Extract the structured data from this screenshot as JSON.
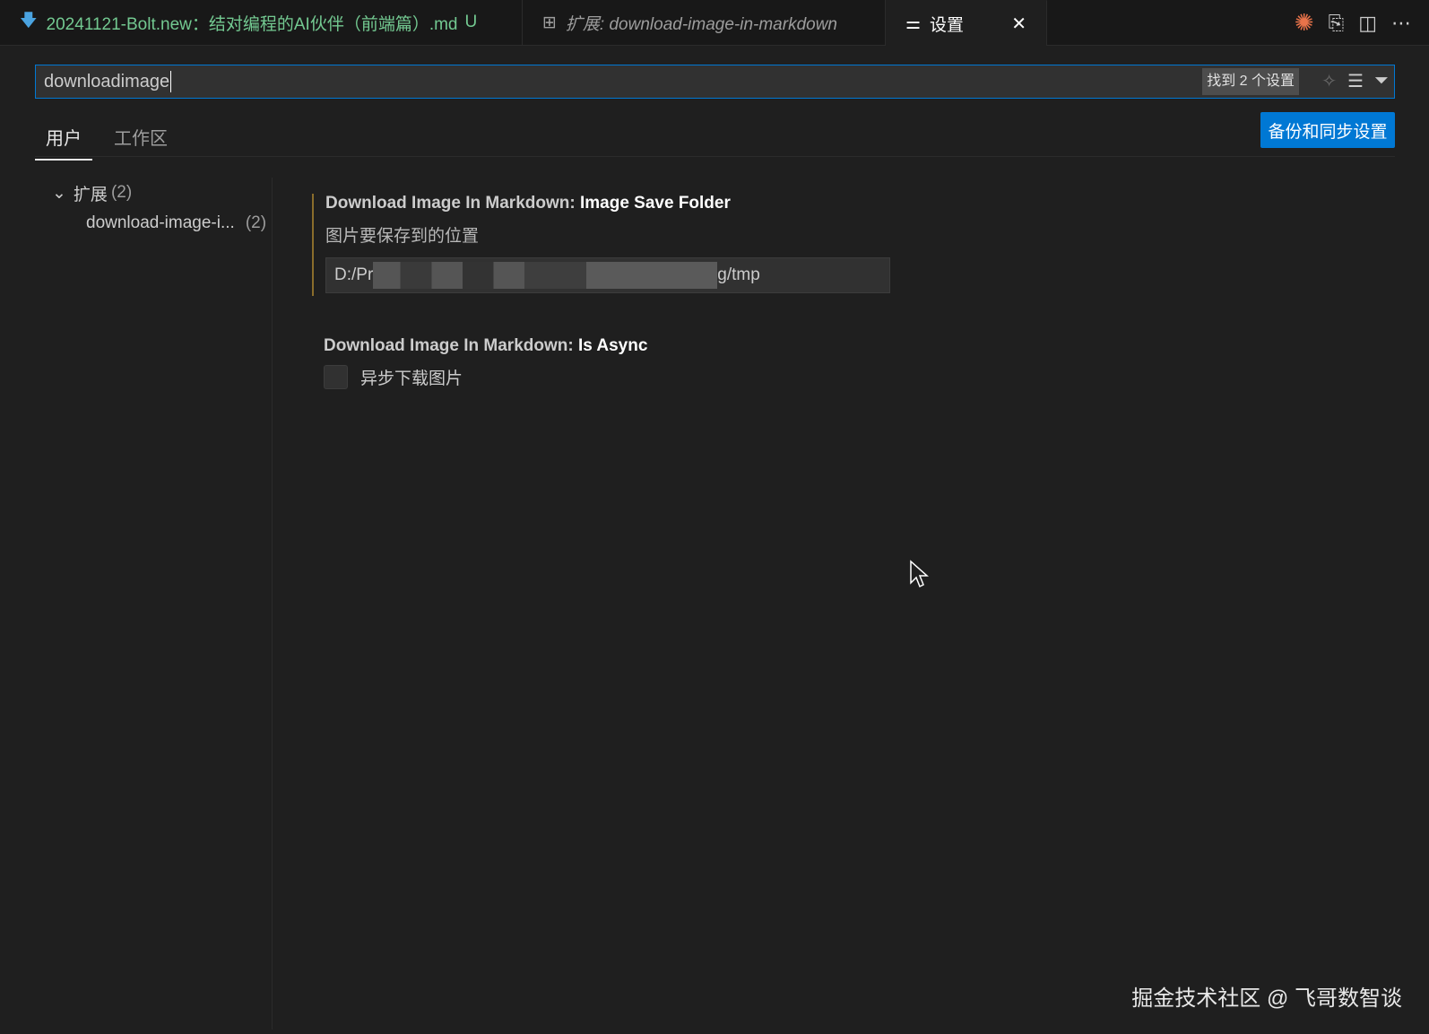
{
  "tabs": [
    {
      "label": "20241121-Bolt.new：结对编程的AI伙伴（前端篇）.md",
      "badge": "U",
      "icon": "markdown-download-icon"
    },
    {
      "label": "扩展: download-image-in-markdown",
      "icon": "extension-preview-icon"
    },
    {
      "label": "设置",
      "icon": "settings-sliders-icon",
      "close": "✕"
    }
  ],
  "search": {
    "value": "downloadimage",
    "result_count": "找到 2 个设置"
  },
  "scope_tabs": [
    {
      "label": "用户",
      "active": true
    },
    {
      "label": "工作区",
      "active": false
    }
  ],
  "sync_button": "备份和同步设置",
  "toc": {
    "group": "扩展",
    "group_count": "(2)",
    "item": "download-image-i...",
    "item_count": "(2)"
  },
  "settings": [
    {
      "prefix": "Download Image In Markdown: ",
      "name": "Image Save Folder",
      "description": "图片要保存到的位置",
      "value_start": "D:/Pr",
      "value_end": "g/tmp"
    },
    {
      "prefix": "Download Image In Markdown: ",
      "name": "Is Async",
      "checkbox_label": "异步下载图片",
      "checked": false
    }
  ],
  "watermark": "掘金技术社区 @ 飞哥数智谈"
}
